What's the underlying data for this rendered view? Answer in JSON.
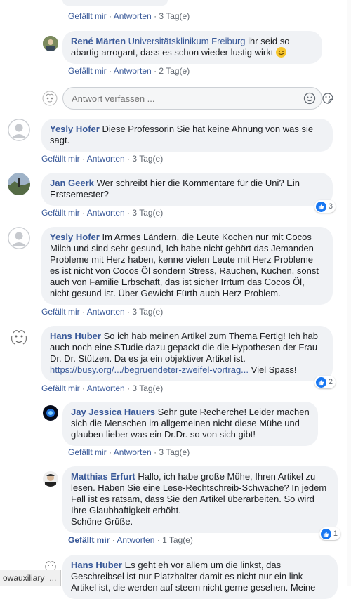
{
  "comments": {
    "top_actions": {
      "like": "Gefällt mir",
      "reply": "Antworten",
      "time": "3 Tag(e)"
    },
    "rene": {
      "author": "René Märten",
      "affiliation": "Universitätsklinikum Freiburg",
      "text": "ihr seid so abartig arrogant, dass es schon wieder lustig wirkt",
      "like": "Gefällt mir",
      "reply": "Antworten",
      "time": "2 Tag(e)"
    },
    "reply_input": {
      "placeholder": "Antwort verfassen ..."
    },
    "yesly1": {
      "author": "Yesly Hofer",
      "text": "Diese Professorin Sie hat keine Ahnung von was sie sagt.",
      "like": "Gefällt mir",
      "reply": "Antworten",
      "time": "3 Tag(e)"
    },
    "jan": {
      "author": "Jan Geerk",
      "text": "Wer schreibt hier die Kommentare für die Uni? Ein Erstsemester?",
      "like": "Gefällt mir",
      "reply": "Antworten",
      "time": "3 Tag(e)",
      "reactions": "3"
    },
    "yesly2": {
      "author": "Yesly Hofer",
      "text": "Im Armes Ländern, die Leute Kochen nur mit Cocos Milch und sind sehr gesund, Ich habe nicht gehört das Jemanden Probleme mit Herz haben, kenne vielen Leute mit Herz Probleme es ist nicht von Cocos Öl sondern Stress, Rauchen, Kuchen, sonst auch von Familie Erbschaft, das ist sicher Irrtum das Cocos Öl, nicht gesund ist. Über Gewicht Fürth auch Herz Problem.",
      "like": "Gefällt mir",
      "reply": "Antworten",
      "time": "3 Tag(e)"
    },
    "hans1": {
      "author": "Hans Huber",
      "text": "So ich hab meinen Artikel zum Thema Fertig! Ich hab auch noch eine STudie dazu gepackt die die Hypothesen der Frau Dr. Dr. Stützen. Da es ja ein objektiver Artikel ist.",
      "link": "https://busy.org/.../begruendeter-zweifel-vortrag...",
      "after_link": "Viel Spass!",
      "like": "Gefällt mir",
      "reply": "Antworten",
      "time": "3 Tag(e)",
      "reactions": "2"
    },
    "jay": {
      "author": "Jay Jessica Hauers",
      "text": "Sehr gute Recherche! Leider machen sich die Menschen im allgemeinen nicht diese Mühe und glauben lieber was ein Dr.Dr. so von sich gibt!",
      "like": "Gefällt mir",
      "reply": "Antworten",
      "time": "3 Tag(e)"
    },
    "matthias": {
      "author": "Matthias Erfurt",
      "text": "Hallo, ich habe große Mühe, Ihren Artikel zu lesen. Haben Sie eine Lese-Rechtschreib-Schwäche? In jedem Fall ist es ratsam, dass Sie den Artikel überarbeiten. So wird Ihre Glaubhaftigkeit erhöht.",
      "closing": "Schöne Grüße.",
      "like": "Gefällt mir",
      "reply": "Antworten",
      "time": "1 Tag(e)",
      "reactions": "1"
    },
    "hans2": {
      "author": "Hans Huber",
      "text": "Es geht eh vor allem um die linkst, das Geschreibsel ist nur Platzhalter damit es nicht nur ein link Artikel ist, die werden auf steem nicht gerne gesehen. Meine"
    }
  },
  "status_bar": {
    "text": "owauxiliary=..."
  },
  "colors": {
    "link": "#385898",
    "bubble": "#f0f2f5",
    "like_blue": "#1877f2"
  }
}
